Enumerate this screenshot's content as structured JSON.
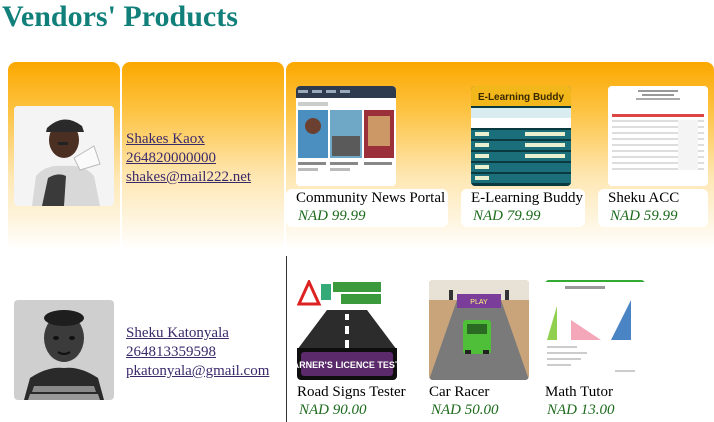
{
  "page": {
    "title": "Vendors' Products"
  },
  "vendors": [
    {
      "name": "Shakes Kaox",
      "phone": "264820000000",
      "email": "shakes@mail222.net",
      "products": [
        {
          "name": "Community News Portal",
          "price": "NAD 99.99"
        },
        {
          "name": "E-Learning Buddy",
          "price": "NAD 79.99"
        },
        {
          "name": "Sheku ACC",
          "price": "NAD 59.99"
        }
      ]
    },
    {
      "name": "Sheku Katonyala",
      "phone": "264813359598",
      "email": "pkatonyala@gmail.com",
      "products": [
        {
          "name": "Road Signs Tester",
          "price": "NAD 90.00"
        },
        {
          "name": "Car Racer",
          "price": "NAD 50.00"
        },
        {
          "name": "Math Tutor",
          "price": "NAD 13.00"
        }
      ]
    }
  ],
  "thumbnail_text": {
    "elearning_banner": "E-Learning Buddy",
    "road_signs_banner": "LEARNER'S LICENCE TESTER",
    "car_racer_sign": "PLAY"
  },
  "colors": {
    "title": "#11807a",
    "row_gradient_top": "#fba800",
    "link": "#3b2a6a",
    "price": "#1e6b1e"
  }
}
